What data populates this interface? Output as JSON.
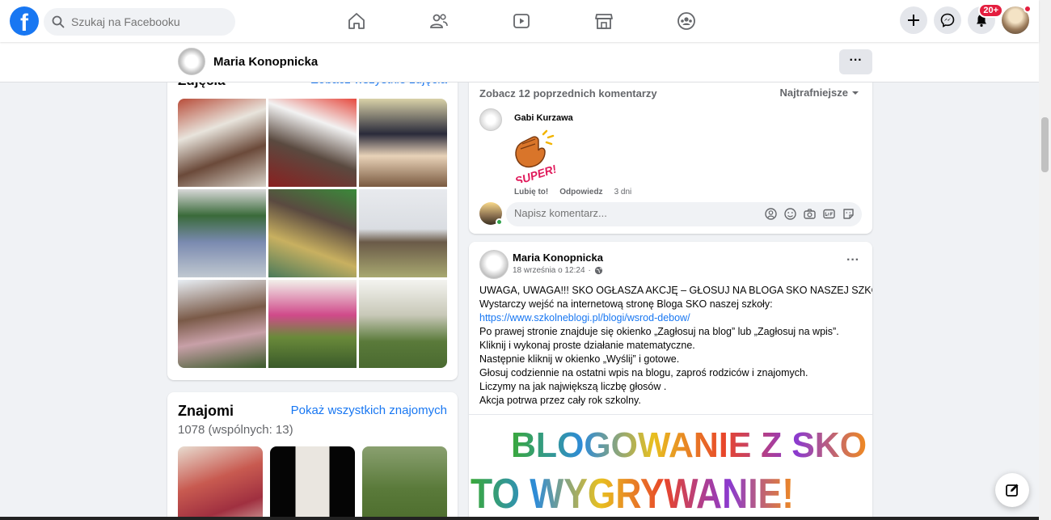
{
  "topnav": {
    "logo_letter": "f",
    "search_placeholder": "Szukaj na Facebooku",
    "nav_icons": [
      "home-icon",
      "friends-icon",
      "watch-icon",
      "marketplace-icon",
      "groups-icon"
    ],
    "notification_badge": "20+"
  },
  "profile_bar": {
    "name": "Maria Konopnicka",
    "more_label": "···"
  },
  "photos": {
    "title": "Zdjęcia",
    "see_all": "Zobacz wszystkie zdjęcia"
  },
  "friends": {
    "title": "Znajomi",
    "see_all": "Pokaż wszystkich znajomych",
    "count": "1078 (wspólnych: 13)"
  },
  "comments": {
    "previous": "Zobacz 12 poprzednich komentarzy",
    "sort_label": "Najtrafniejsze",
    "comment": {
      "author": "Gabi Kurzawa",
      "sticker_text": "SUPER!",
      "like": "Lubię to!",
      "reply": "Odpowiedz",
      "time": "3 dni"
    },
    "composer_placeholder": "Napisz komentarz..."
  },
  "post": {
    "author": "Maria Konopnicka",
    "date": "18 września o 12:24",
    "separator": "·",
    "more_label": "···",
    "lines": [
      "UWAGA, UWAGA!!! SKO OGŁASZA AKCJĘ – GŁOSUJ NA BLOGA SKO NASZEJ SZKOŁY",
      "Wystarczy wejść na internetową stronę  Bloga SKO naszej szkoły:",
      "https://www.szkolneblogi.pl/blogi/wsrod-debow/",
      "Po prawej stronie znajduje się okienko „Zagłosuj na blog” lub „Zagłosuj na wpis”.",
      "Kliknij i wykonaj proste działanie matematyczne.",
      "Następnie kliknij w okienko „Wyślij” i gotowe.",
      "Głosuj codziennie na ostatni wpis na blogu, zaproś rodziców i znajomych.",
      "Liczymy na jak największą liczbę głosów .",
      "Akcja potrwa przez cały rok szkolny."
    ],
    "banner_line1": "BLOGOWANIE Z SKO",
    "banner_line2": "TO WYGRYWANIE!"
  },
  "colors": {
    "accent": "#1877f2",
    "background": "#f0f2f5",
    "badge": "#e41e3f"
  }
}
